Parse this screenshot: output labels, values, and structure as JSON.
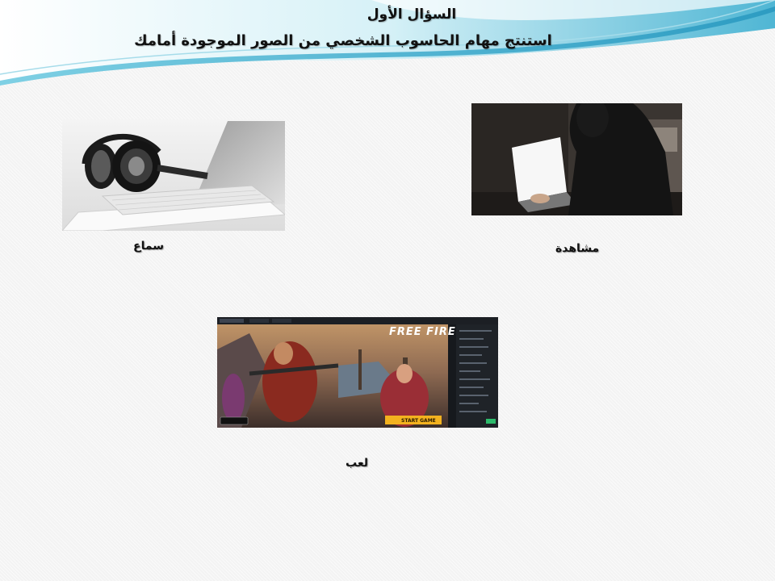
{
  "slide": {
    "title": "السؤال الأول",
    "subtitle": "استنتج مهام الحاسوب الشخصي من الصور الموجودة أمامك"
  },
  "items": [
    {
      "id": "listening",
      "caption": "سماع",
      "image_icon": "headphones-laptop-photo"
    },
    {
      "id": "watching",
      "caption": "مشاهدة",
      "image_icon": "person-at-laptop-photo"
    },
    {
      "id": "playing",
      "caption": "لعب",
      "image_icon": "game-screenshot"
    }
  ],
  "game": {
    "logo": "FREE FIRE",
    "start_button": "START GAME"
  },
  "colors": {
    "wave_light": "#c9ecf4",
    "wave_mid": "#6ec6dc",
    "wave_dark": "#2d9cc2",
    "caption_text": "#111111"
  }
}
